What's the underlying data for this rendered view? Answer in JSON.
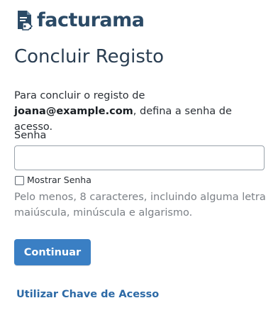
{
  "brand": {
    "name": "facturama",
    "logo_icon": "document-tag-icon",
    "color": "#2b4a66"
  },
  "title": "Concluir Registo",
  "intro": {
    "before": "Para concluir o registo de ",
    "email": "joana@example.com",
    "after": ", defina a senha de acesso."
  },
  "password": {
    "label": "Senha",
    "value": "",
    "placeholder": ""
  },
  "show_password": {
    "label": "Mostrar Senha",
    "checked": false
  },
  "hint": "Pelo menos, 8 caracteres, incluindo alguma letra maiúscula, minúscula e algarismo.",
  "actions": {
    "continue_label": "Continuar",
    "access_key_label": "Utilizar Chave de Acesso"
  },
  "colors": {
    "primary_button": "#3a7fc4",
    "link": "#2d6aa6",
    "hint_text": "#7b8086"
  }
}
